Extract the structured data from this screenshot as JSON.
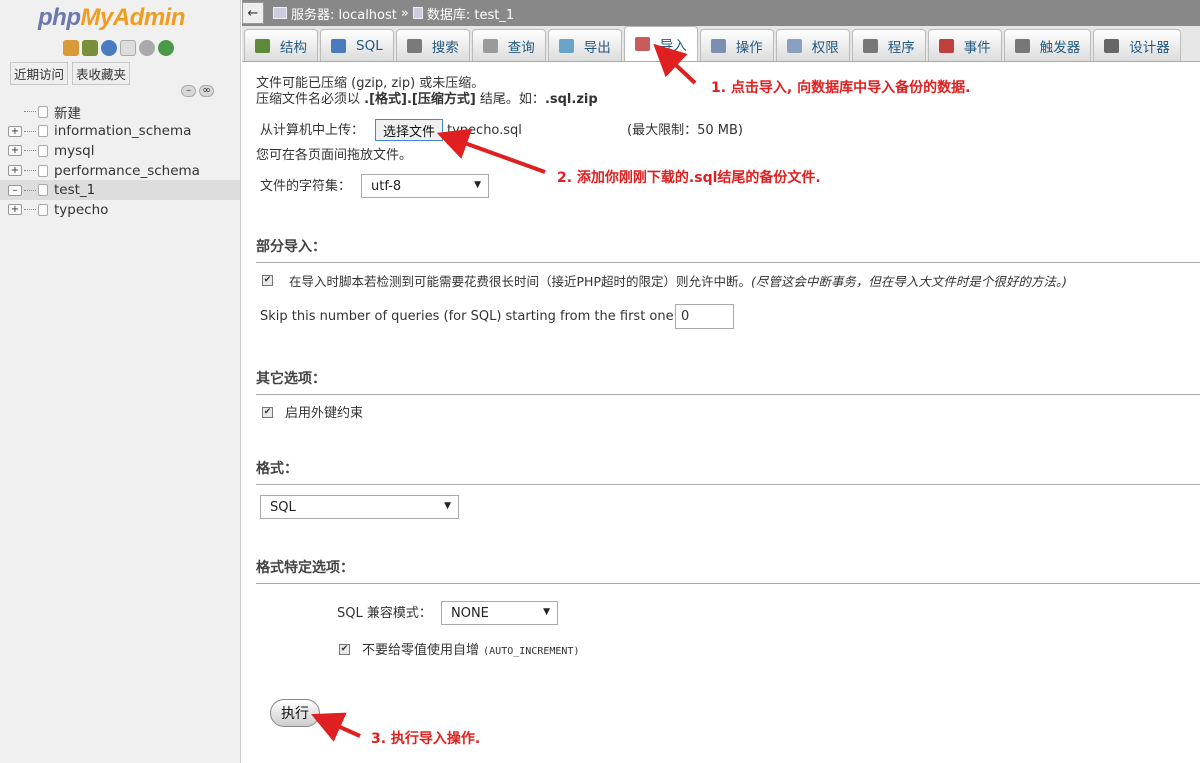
{
  "sidebar": {
    "logo_php": "php",
    "logo_admin": "MyAdmin",
    "tabs": [
      "近期访问",
      "表收藏夹"
    ],
    "tree": [
      {
        "label": "新建"
      },
      {
        "label": "information_schema"
      },
      {
        "label": "mysql"
      },
      {
        "label": "performance_schema"
      },
      {
        "label": "test_1",
        "active": true
      },
      {
        "label": "typecho"
      }
    ]
  },
  "topbar": {
    "back": "←",
    "server": "服务器: localhost",
    "separator": "»",
    "database": "数据库: test_1"
  },
  "menu": [
    {
      "label": "结构",
      "icon": "structure-icon",
      "color": "#5d8a3a"
    },
    {
      "label": "SQL",
      "icon": "sql-icon",
      "color": "#4a7bbf"
    },
    {
      "label": "搜索",
      "icon": "search-icon",
      "color": "#7a7a7a"
    },
    {
      "label": "查询",
      "icon": "query-icon",
      "color": "#9a9a9a"
    },
    {
      "label": "导出",
      "icon": "export-icon",
      "color": "#6aa3c8"
    },
    {
      "label": "导入",
      "icon": "import-icon",
      "color": "#c95b5b",
      "active": true
    },
    {
      "label": "操作",
      "icon": "wrench-icon",
      "color": "#7b8fb3"
    },
    {
      "label": "权限",
      "icon": "privileges-icon",
      "color": "#8aa0c0"
    },
    {
      "label": "程序",
      "icon": "routines-icon",
      "color": "#777"
    },
    {
      "label": "事件",
      "icon": "clock-icon",
      "color": "#c04040"
    },
    {
      "label": "触发器",
      "icon": "triggers-icon",
      "color": "#777"
    },
    {
      "label": "设计器",
      "icon": "designer-icon",
      "color": "#666"
    }
  ],
  "import": {
    "note_line1": "文件可能已压缩 (gzip, zip) 或未压缩。",
    "note_line2_a": "压缩文件名必须以 ",
    "note_line2_b": ".[格式].[压缩方式]",
    "note_line2_c": " 结尾。如：",
    "note_line2_d": ".sql.zip",
    "upload_label": "从计算机中上传：",
    "choose_file": "选择文件",
    "file_name": "typecho.sql",
    "max_limit": "(最大限制：50 MB)",
    "drag_hint": "您可在各页面间拖放文件。",
    "charset_label": "文件的字符集：",
    "charset_value": "utf-8"
  },
  "partial": {
    "title": "部分导入：",
    "allow_interrupt": "在导入时脚本若检测到可能需要花费很长时间（接近PHP超时的限定）则允许中断。",
    "allow_interrupt_note": "(尽管这会中断事务，但在导入大文件时是个很好的方法。)",
    "skip_label": "Skip this number of queries (for SQL) starting from the first one:",
    "skip_value": "0"
  },
  "other": {
    "title": "其它选项：",
    "fk_checks": "启用外键约束"
  },
  "format": {
    "title": "格式：",
    "value": "SQL"
  },
  "format_specific": {
    "title": "格式特定选项：",
    "compat_label": "SQL 兼容模式：",
    "compat_value": "NONE",
    "no_auto_value_a": "不要给零值使用自增 ",
    "no_auto_value_b": "(AUTO_INCREMENT)"
  },
  "go_button": "执行",
  "annotations": {
    "a1": "1. 点击导入, 向数据库中导入备份的数据.",
    "a2": "2. 添加你刚刚下载的.sql结尾的备份文件.",
    "a3": "3. 执行导入操作."
  },
  "colors": {
    "annotation": "#e02020",
    "link": "#235a81"
  }
}
